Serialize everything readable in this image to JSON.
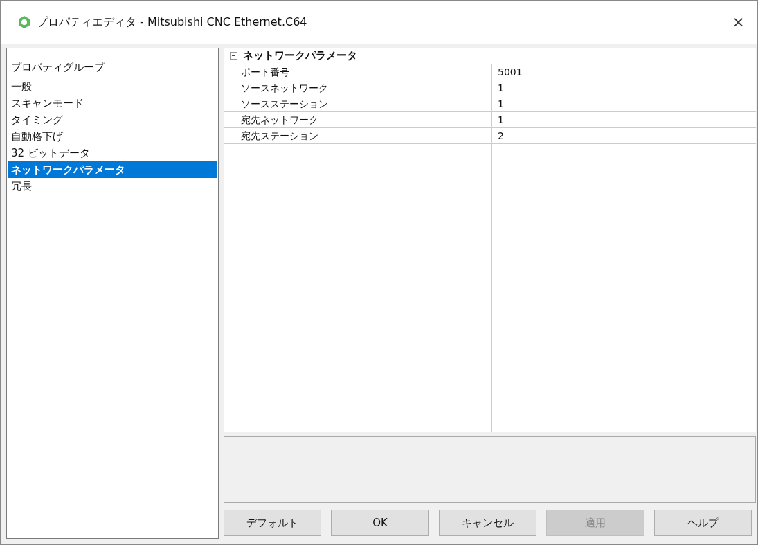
{
  "window": {
    "title": "プロパティエディタ - Mitsubishi CNC Ethernet.C64",
    "close": "×"
  },
  "sidebar": {
    "header": "プロパティグループ",
    "items": [
      {
        "label": "一般",
        "selected": false
      },
      {
        "label": "スキャンモード",
        "selected": false
      },
      {
        "label": "タイミング",
        "selected": false
      },
      {
        "label": "自動格下げ",
        "selected": false
      },
      {
        "label": "32 ビットデータ",
        "selected": false
      },
      {
        "label": "ネットワークパラメータ",
        "selected": true
      },
      {
        "label": "冗長",
        "selected": false
      }
    ]
  },
  "property_grid": {
    "category": "ネットワークパラメータ",
    "expanded": true,
    "rows": [
      {
        "name": "ポート番号",
        "value": "5001"
      },
      {
        "name": "ソースネットワーク",
        "value": "1"
      },
      {
        "name": "ソースステーション",
        "value": "1"
      },
      {
        "name": "宛先ネットワーク",
        "value": "1"
      },
      {
        "name": "宛先ステーション",
        "value": "2"
      }
    ]
  },
  "buttons": [
    {
      "label": "デフォルト",
      "disabled": false
    },
    {
      "label": "OK",
      "disabled": false
    },
    {
      "label": "キャンセル",
      "disabled": false
    },
    {
      "label": "適用",
      "disabled": true
    },
    {
      "label": "ヘルプ",
      "disabled": false
    }
  ]
}
